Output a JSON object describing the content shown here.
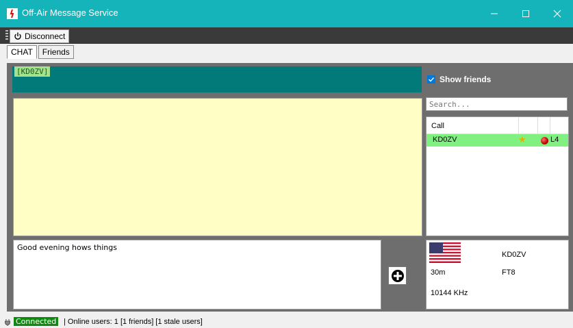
{
  "window": {
    "title": "Off-Air Message Service"
  },
  "toolbar": {
    "disconnect_label": "Disconnect"
  },
  "tabs": [
    {
      "label": "CHAT"
    },
    {
      "label": "Friends"
    }
  ],
  "chat": {
    "current_call": "[KD0ZV]",
    "message_input": "Good evening hows things"
  },
  "sidebar": {
    "show_friends_label": "Show friends",
    "search_placeholder": "Search...",
    "list_header": "Call",
    "rows": [
      {
        "call": "KD0ZV",
        "level": "L4"
      }
    ]
  },
  "info": {
    "call": "KD0ZV",
    "band": "30m",
    "mode": "FT8",
    "freq": "10144 KHz"
  },
  "status": {
    "connection": "Connected",
    "text": "|  Online users:  1 [1 friends] [1 stale users]"
  },
  "colors": {
    "titlebar": "#15b4bb",
    "callbar": "#027a7a",
    "chat_bg": "#ffffc5",
    "friend_row": "#80f080",
    "connected": "#118811"
  }
}
